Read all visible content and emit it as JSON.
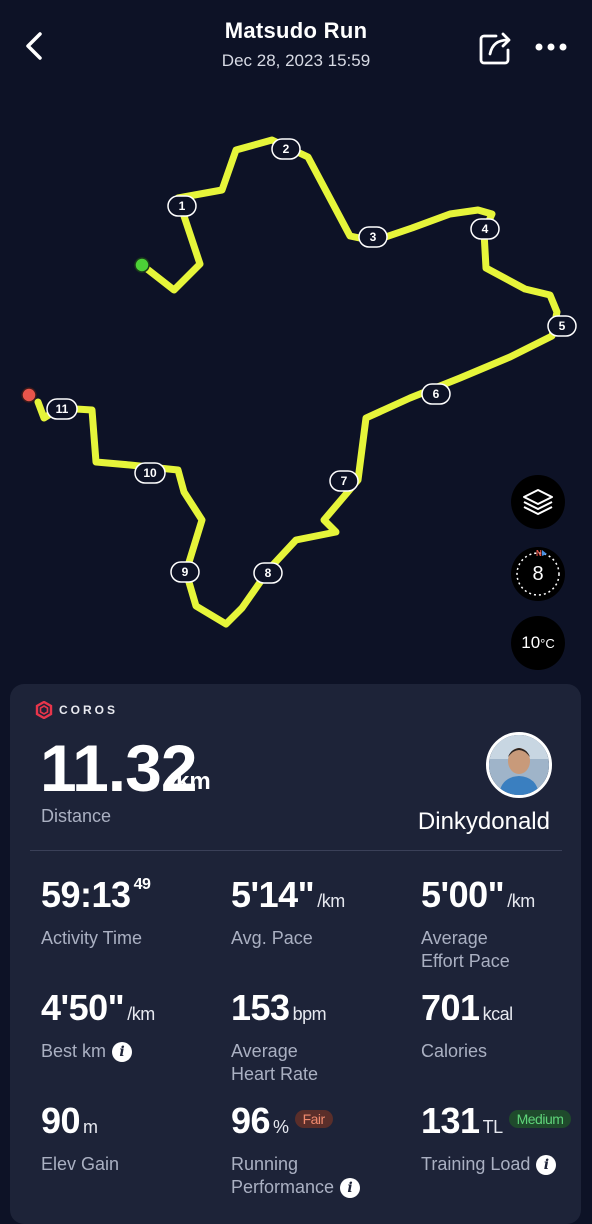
{
  "header": {
    "title": "Matsudo Run",
    "subtitle": "Dec 28, 2023 15:59"
  },
  "map": {
    "route_color": "#e6f53a",
    "start_color": "#4cd137",
    "end_color": "#e8554b",
    "km_markers": [
      "1",
      "2",
      "3",
      "4",
      "5",
      "6",
      "7",
      "8",
      "9",
      "10",
      "11"
    ],
    "compass_value": "8",
    "temperature_value": "10",
    "temperature_unit": "°C"
  },
  "card": {
    "logo_text": "COROS",
    "distance_value": "11.32",
    "distance_unit": "km",
    "distance_label": "Distance",
    "username": "Dinkydonald",
    "stats": {
      "activity_time": {
        "value": "59:13",
        "sup": "49",
        "label": "Activity Time"
      },
      "avg_pace": {
        "value": "5'14\"",
        "unit": "/km",
        "label": "Avg. Pace"
      },
      "effort_pace": {
        "value": "5'00\"",
        "unit": "/km",
        "label1": "Average",
        "label2": "Effort Pace"
      },
      "best_km": {
        "value": "4'50\"",
        "unit": "/km",
        "label": "Best km"
      },
      "heart_rate": {
        "value": "153",
        "unit": "bpm",
        "label1": "Average",
        "label2": "Heart Rate"
      },
      "calories": {
        "value": "701",
        "unit": "kcal",
        "label": "Calories"
      },
      "elev_gain": {
        "value": "90",
        "unit": "m",
        "label": "Elev Gain"
      },
      "running_performance": {
        "value": "96",
        "unit": "%",
        "badge": "Fair",
        "label1": "Running",
        "label2": "Performance"
      },
      "training_load": {
        "value": "131",
        "unit": "TL",
        "badge": "Medium",
        "label": "Training Load"
      }
    }
  }
}
